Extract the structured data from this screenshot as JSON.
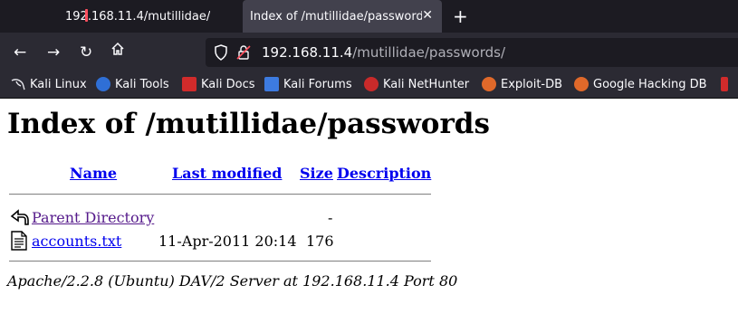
{
  "browser": {
    "tabs": [
      {
        "title": "192.168.11.4/mutillidae/"
      },
      {
        "title": "Index of /mutillidae/passwords/"
      }
    ],
    "url_host": "192.168.11.4",
    "url_path": "/mutillidae/passwords/",
    "bookmarks": [
      {
        "label": "Kali Linux",
        "icon": "kali-dragon-icon"
      },
      {
        "label": "Kali Tools",
        "icon": "kali-tools-icon"
      },
      {
        "label": "Kali Docs",
        "icon": "kali-docs-icon"
      },
      {
        "label": "Kali Forums",
        "icon": "kali-forums-icon"
      },
      {
        "label": "Kali NetHunter",
        "icon": "nethunter-icon"
      },
      {
        "label": "Exploit-DB",
        "icon": "exploit-db-icon"
      },
      {
        "label": "Google Hacking DB",
        "icon": "ghdb-icon"
      }
    ]
  },
  "page": {
    "heading": "Index of /mutillidae/passwords",
    "columns": {
      "name": "Name",
      "last_modified": "Last modified",
      "size": "Size",
      "description": "Description"
    },
    "rows": [
      {
        "icon": "back-arrow-icon",
        "name": "Parent Directory",
        "last_modified": "",
        "size": "-",
        "description": ""
      },
      {
        "icon": "text-file-icon",
        "name": "accounts.txt",
        "last_modified": "11-Apr-2011 20:14",
        "size": "176",
        "description": ""
      }
    ],
    "server_signature": "Apache/2.2.8 (Ubuntu) DAV/2 Server at 192.168.11.4 Port 80"
  },
  "colors": {
    "link": "#0000ee",
    "visited_link": "#551a8b",
    "chrome_dark": "#1c1b22",
    "chrome": "#2b2a33"
  }
}
